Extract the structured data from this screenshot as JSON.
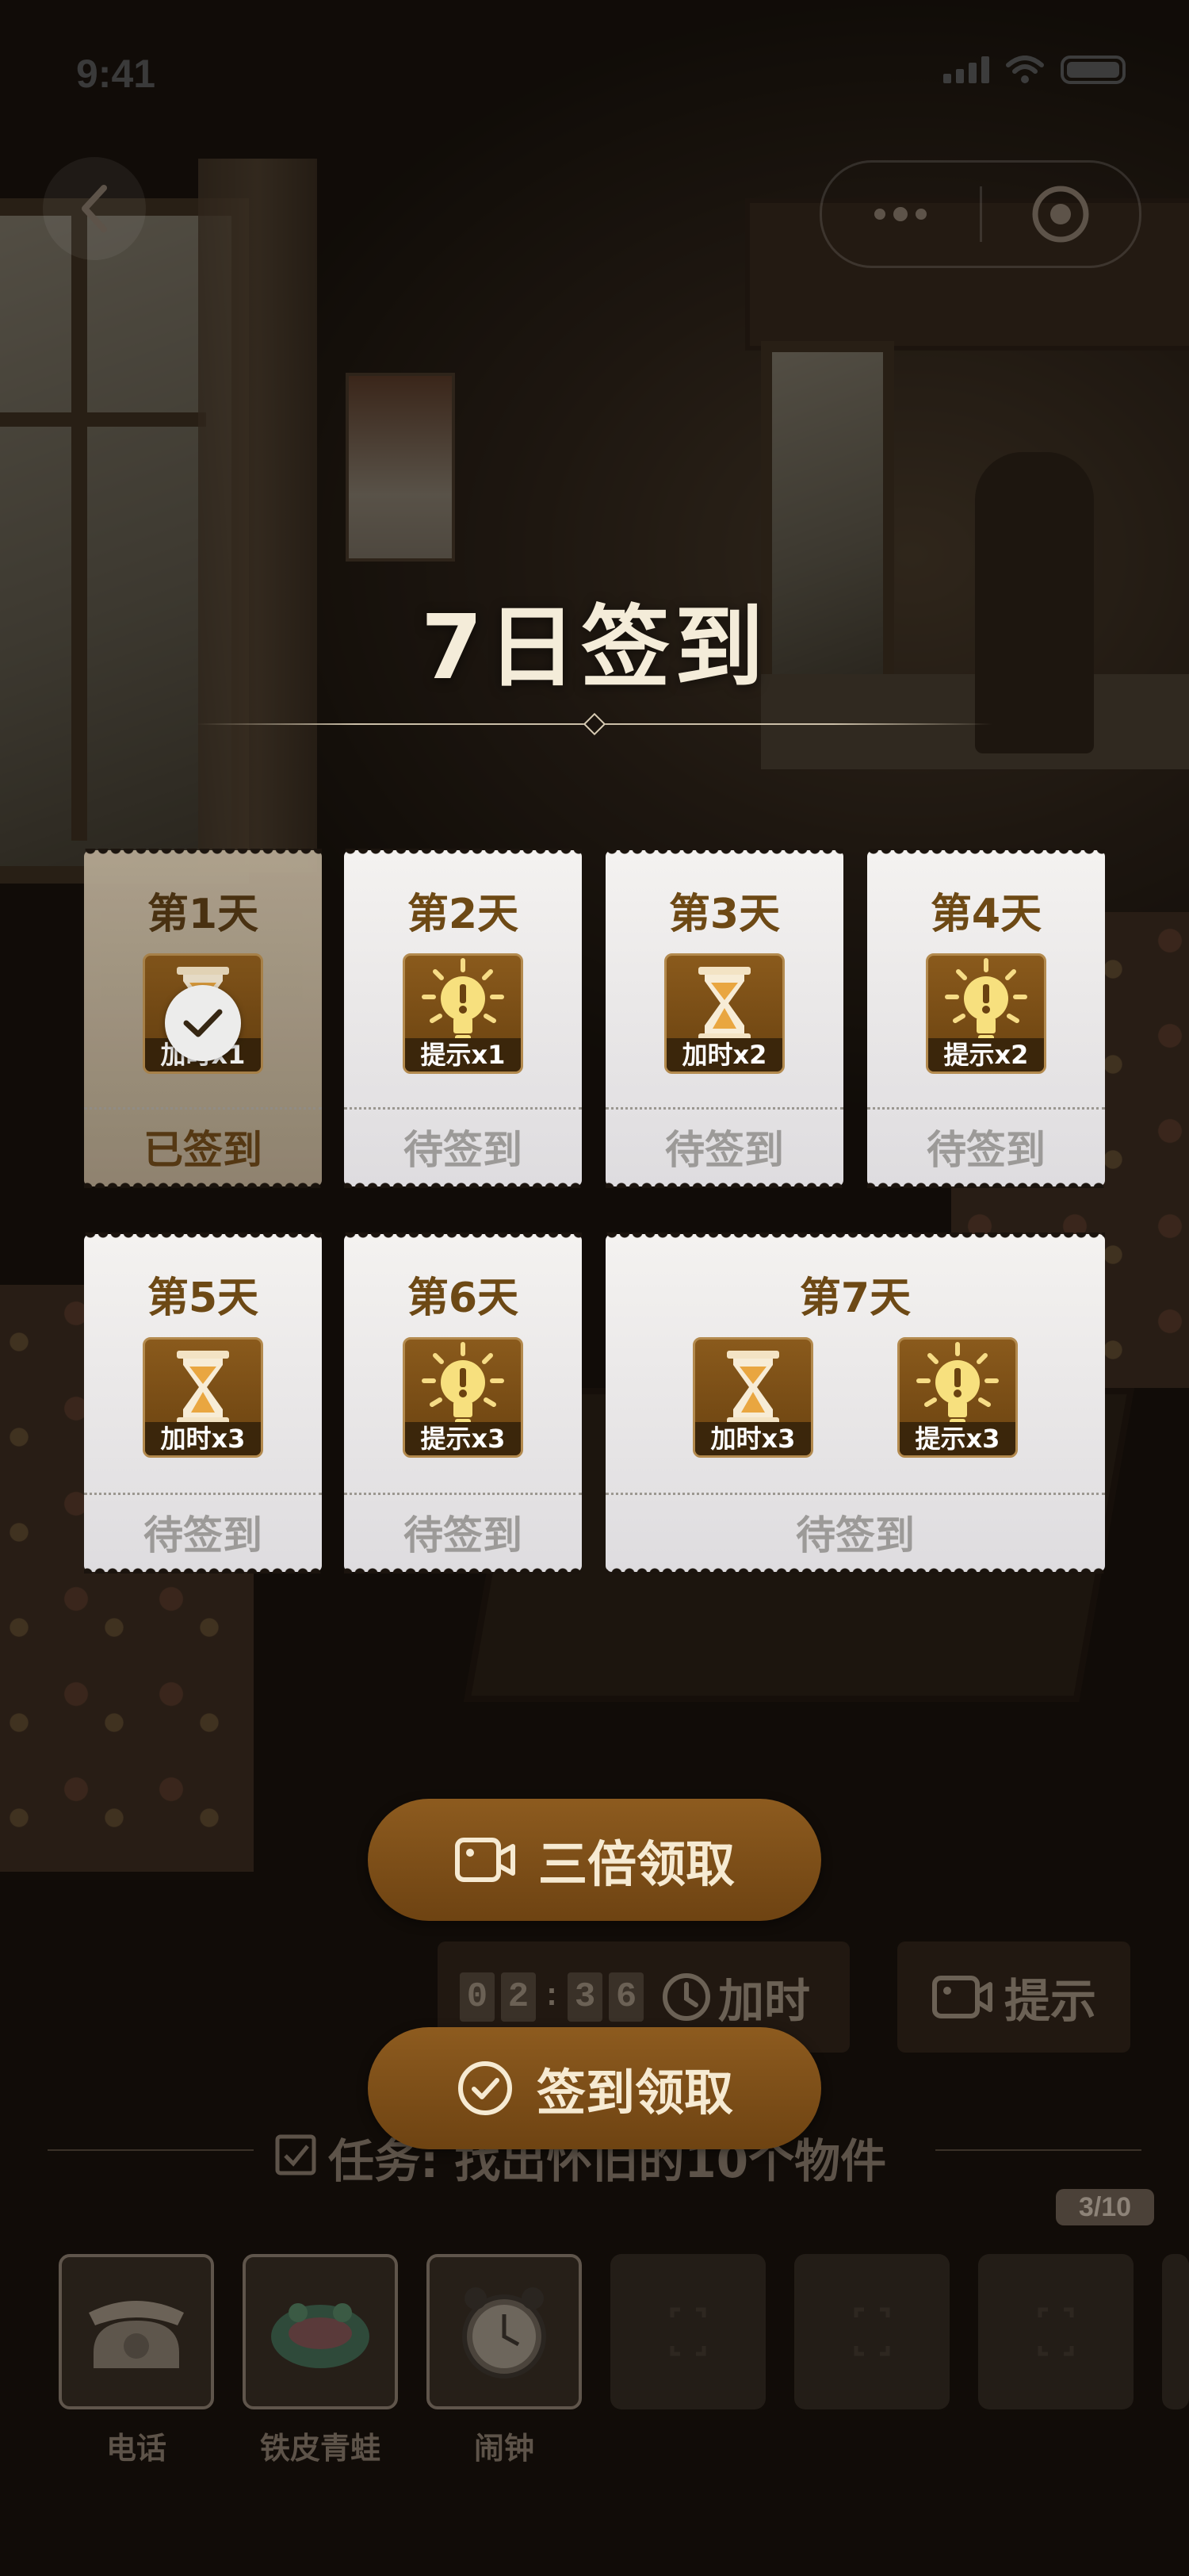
{
  "status_bar": {
    "time": "9:41"
  },
  "title": "7日签到",
  "days": [
    {
      "day": "第1天",
      "status": "已签到",
      "signed": true,
      "rewards": [
        {
          "icon": "hourglass-icon",
          "label": "加时x1"
        }
      ]
    },
    {
      "day": "第2天",
      "status": "待签到",
      "signed": false,
      "rewards": [
        {
          "icon": "lightbulb-icon",
          "label": "提示x1"
        }
      ]
    },
    {
      "day": "第3天",
      "status": "待签到",
      "signed": false,
      "rewards": [
        {
          "icon": "hourglass-icon",
          "label": "加时x2"
        }
      ]
    },
    {
      "day": "第4天",
      "status": "待签到",
      "signed": false,
      "rewards": [
        {
          "icon": "lightbulb-icon",
          "label": "提示x2"
        }
      ]
    },
    {
      "day": "第5天",
      "status": "待签到",
      "signed": false,
      "rewards": [
        {
          "icon": "hourglass-icon",
          "label": "加时x3"
        }
      ]
    },
    {
      "day": "第6天",
      "status": "待签到",
      "signed": false,
      "rewards": [
        {
          "icon": "lightbulb-icon",
          "label": "提示x3"
        }
      ]
    },
    {
      "day": "第7天",
      "status": "待签到",
      "signed": false,
      "rewards": [
        {
          "icon": "hourglass-icon",
          "label": "加时x3"
        },
        {
          "icon": "lightbulb-icon",
          "label": "提示x3"
        }
      ]
    }
  ],
  "buttons": {
    "triple_claim": "三倍领取",
    "sign_claim": "签到领取"
  },
  "background_game": {
    "timer_digits": [
      "0",
      "2",
      ":",
      "3",
      "6"
    ],
    "add_time_label": "加时",
    "hint_label": "提示",
    "task_text": "任务: 找出怀旧的10个物件",
    "progress": "3/10",
    "items": [
      {
        "name": "电话",
        "found": true
      },
      {
        "name": "铁皮青蛙",
        "found": true
      },
      {
        "name": "闹钟",
        "found": true
      }
    ]
  }
}
